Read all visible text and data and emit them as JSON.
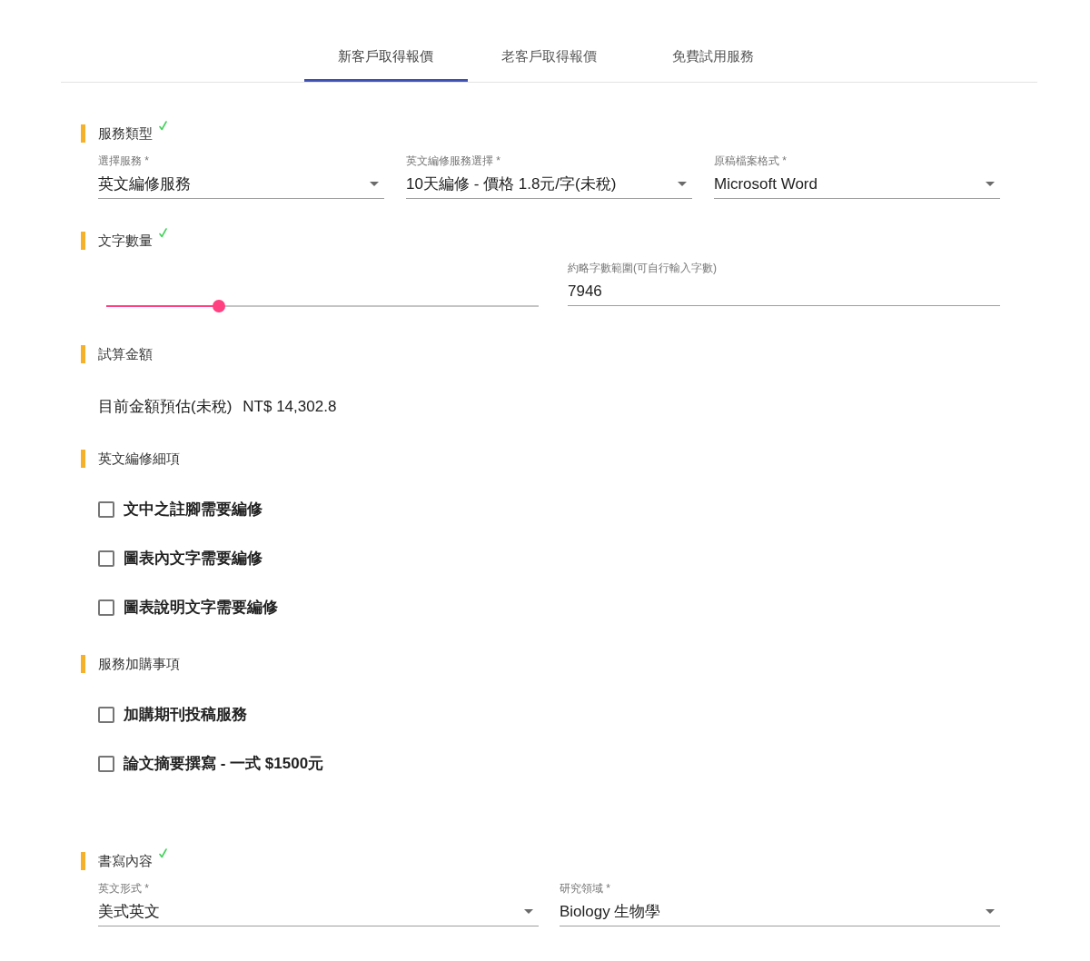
{
  "tabs": [
    {
      "label": "新客戶取得報價",
      "selected": true
    },
    {
      "label": "老客戶取得報價",
      "selected": false
    },
    {
      "label": "免費試用服務",
      "selected": false
    }
  ],
  "sections": [
    {
      "kind": "selects",
      "title": "服務類型",
      "completed": true,
      "fields": [
        {
          "label": "選擇服務 *",
          "value": "英文編修服務"
        },
        {
          "label": "英文編修服務選擇 *",
          "value": "10天編修 - 價格 1.8元/字(未稅)"
        },
        {
          "label": "原稿檔案格式 *",
          "value": "Microsoft Word"
        }
      ]
    },
    {
      "kind": "word_count",
      "title": "文字數量",
      "completed": true,
      "slider": {
        "level": 0.26
      },
      "field": {
        "label": "約略字數範圍(可自行輸入字數)",
        "value": "7946"
      }
    },
    {
      "kind": "estimate",
      "title": "試算金額",
      "completed": false,
      "label": "目前金額預估(未稅)",
      "amount": "NT$ 14,302.8"
    },
    {
      "kind": "checkboxes",
      "title": "英文編修細項",
      "completed": false,
      "options": [
        {
          "label": "文中之註腳需要編修",
          "checked": false
        },
        {
          "label": "圖表內文字需要編修",
          "checked": false
        },
        {
          "label": "圖表說明文字需要編修",
          "checked": false
        }
      ]
    },
    {
      "kind": "checkboxes",
      "title": "服務加購事項",
      "completed": false,
      "options": [
        {
          "label": "加購期刊投稿服務",
          "checked": false
        },
        {
          "label": "論文摘要撰寫 - 一式 $1500元",
          "checked": false
        }
      ]
    },
    {
      "kind": "selects",
      "title": "書寫內容",
      "completed": true,
      "fields": [
        {
          "label": "英文形式 *",
          "value": "美式英文"
        },
        {
          "label": "研究領域 *",
          "value": "Biology 生物學"
        }
      ]
    }
  ]
}
